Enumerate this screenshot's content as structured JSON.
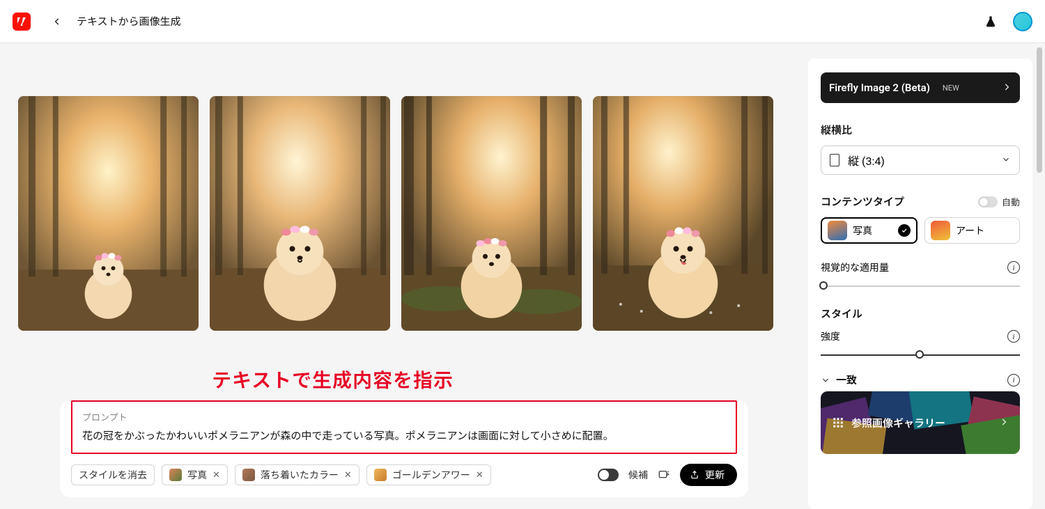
{
  "header": {
    "title": "テキストから画像生成"
  },
  "annotation": "テキストで生成内容を指示",
  "prompt": {
    "label": "プロンプト",
    "text": "花の冠をかぶったかわいいポメラニアンが森の中で走っている写真。ポメラニアンは画面に対して小さめに配置。"
  },
  "pills": {
    "clear": "スタイルを消去",
    "photo": "写真",
    "muted": "落ち着いたカラー",
    "golden": "ゴールデンアワー"
  },
  "promptActions": {
    "candidate": "候補",
    "refresh": "更新"
  },
  "sidebar": {
    "model_name": "Firefly Image 2 (Beta)",
    "model_badge": "NEW",
    "aspect_title": "縦横比",
    "aspect_value": "縦 (3:4)",
    "ctype_title": "コンテンツタイプ",
    "ctype_auto": "自動",
    "ctype_photo": "写真",
    "ctype_art": "アート",
    "visual_title": "視覚的な適用量",
    "style_title": "スタイル",
    "intensity_title": "強度",
    "match_title": "一致",
    "gallery_label": "参照画像ギャラリー"
  }
}
